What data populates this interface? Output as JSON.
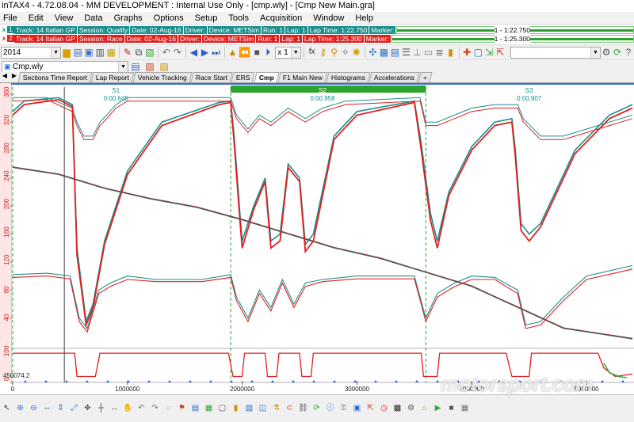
{
  "window": {
    "title": "inTAX4 - 4.72.08.04 - MM DEVELOPMENT : Internal Use Only  - [cmp.wly] - [Cmp New Main.gra]"
  },
  "menu": {
    "items": [
      "File",
      "Edit",
      "View",
      "Data",
      "Graphs",
      "Options",
      "Setup",
      "Tools",
      "Acquisition",
      "Window",
      "Help"
    ]
  },
  "runs": [
    {
      "close": "x",
      "num": "1",
      "color": "#1a8f8f",
      "cells": [
        "Track: 14 Italian GP",
        "Session: Qualify",
        "Date: 02-Aug-16",
        "Driver:",
        "Device: METSim",
        "Run: 1",
        "Lap: 1",
        "Lap Time: 1:22.750",
        "Marker:"
      ],
      "lap_label": "1 - 1:22.750"
    },
    {
      "close": "x",
      "num": "2",
      "color": "#e0201f",
      "cells": [
        "Track: 14 Italian GP",
        "Session: Race",
        "Date: 02-Aug-16",
        "Driver:",
        "Device: METSim",
        "Run: 1",
        "Lap: 1",
        "Lap Time: 1:25.300",
        "Marker:"
      ],
      "lap_label": "1 - 1:25.300"
    }
  ],
  "toolbar": {
    "year_combo": "2014",
    "speed_combo": "x 1",
    "right_combo": "",
    "workspace_combo": "Cmp.wly"
  },
  "tabs": [
    {
      "label": "Sections Time Report",
      "active": false
    },
    {
      "label": "Lap Report",
      "active": false
    },
    {
      "label": "Vehicle Tracking",
      "active": false
    },
    {
      "label": "Race Start",
      "active": false
    },
    {
      "label": "ERS",
      "active": false
    },
    {
      "label": "Cmp",
      "active": true
    },
    {
      "label": "F1 Main New",
      "active": false
    },
    {
      "label": "Histograms",
      "active": false
    },
    {
      "label": "Accelerations",
      "active": false
    },
    {
      "label": "+",
      "active": false
    }
  ],
  "plot": {
    "sectors": [
      {
        "name": "S1",
        "delta": "0:00.645"
      },
      {
        "name": "S2",
        "delta": "0:00.958"
      },
      {
        "name": "S3",
        "delta": "0:00.907"
      }
    ],
    "y_left_ticks_top": [
      "360",
      "320",
      "280",
      "240",
      "200",
      "160",
      "120",
      "80",
      "40"
    ],
    "y_left_ticks_bottom": [
      "100",
      "0"
    ],
    "cursor_value": "450074.2",
    "x_ticks": [
      "0",
      "1000000",
      "2000000",
      "3000000",
      "4000000",
      "5000000"
    ]
  },
  "chart_data": {
    "type": "line",
    "x_range": [
      0,
      5400000
    ],
    "x_ticks": [
      0,
      1000000,
      2000000,
      3000000,
      4000000,
      5000000
    ],
    "series": [
      {
        "color": "#1a8f8f",
        "speed": [
          [
            0,
            335
          ],
          [
            100000,
            350
          ],
          [
            400000,
            355
          ],
          [
            520000,
            345
          ],
          [
            560000,
            140
          ],
          [
            640000,
            35
          ],
          [
            700000,
            60
          ],
          [
            800000,
            150
          ],
          [
            1000000,
            250
          ],
          [
            1300000,
            320
          ],
          [
            1800000,
            348
          ],
          [
            1900000,
            350
          ],
          [
            1930000,
            300
          ],
          [
            1980000,
            190
          ],
          [
            2000000,
            150
          ],
          [
            2100000,
            200
          ],
          [
            2200000,
            240
          ],
          [
            2250000,
            150
          ],
          [
            2330000,
            160
          ],
          [
            2400000,
            260
          ],
          [
            2500000,
            240
          ],
          [
            2550000,
            145
          ],
          [
            2620000,
            160
          ],
          [
            2800000,
            300
          ],
          [
            3000000,
            335
          ],
          [
            3500000,
            350
          ],
          [
            3560000,
            290
          ],
          [
            3640000,
            190
          ],
          [
            3700000,
            150
          ],
          [
            3800000,
            220
          ],
          [
            4000000,
            285
          ],
          [
            4200000,
            320
          ],
          [
            4350000,
            325
          ],
          [
            4380000,
            280
          ],
          [
            4430000,
            175
          ],
          [
            4500000,
            160
          ],
          [
            4600000,
            175
          ],
          [
            4900000,
            280
          ],
          [
            5200000,
            330
          ],
          [
            5400000,
            345
          ]
        ],
        "gear": [
          [
            0,
            355
          ],
          [
            300000,
            355
          ],
          [
            520000,
            340
          ],
          [
            560000,
            320
          ],
          [
            620000,
            300
          ],
          [
            700000,
            300
          ],
          [
            760000,
            320
          ],
          [
            820000,
            330
          ],
          [
            900000,
            345
          ],
          [
            1000000,
            355
          ],
          [
            1900000,
            355
          ],
          [
            1950000,
            330
          ],
          [
            2050000,
            310
          ],
          [
            2150000,
            330
          ],
          [
            2250000,
            320
          ],
          [
            2400000,
            340
          ],
          [
            2550000,
            325
          ],
          [
            2700000,
            340
          ],
          [
            2900000,
            350
          ],
          [
            3550000,
            355
          ],
          [
            3600000,
            320
          ],
          [
            3700000,
            320
          ],
          [
            3850000,
            330
          ],
          [
            4000000,
            340
          ],
          [
            4200000,
            345
          ],
          [
            4400000,
            345
          ],
          [
            4450000,
            325
          ],
          [
            4600000,
            300
          ],
          [
            4800000,
            300
          ],
          [
            5000000,
            310
          ],
          [
            5200000,
            320
          ],
          [
            5400000,
            330
          ]
        ],
        "rpm": [
          [
            0,
            102
          ],
          [
            300000,
            104
          ],
          [
            500000,
            100
          ],
          [
            580000,
            40
          ],
          [
            650000,
            25
          ],
          [
            750000,
            80
          ],
          [
            850000,
            90
          ],
          [
            1000000,
            100
          ],
          [
            1250000,
            95
          ],
          [
            1650000,
            95
          ],
          [
            1900000,
            102
          ],
          [
            1950000,
            70
          ],
          [
            2050000,
            40
          ],
          [
            2150000,
            80
          ],
          [
            2250000,
            55
          ],
          [
            2350000,
            95
          ],
          [
            2450000,
            60
          ],
          [
            2550000,
            90
          ],
          [
            2700000,
            95
          ],
          [
            3000000,
            100
          ],
          [
            3500000,
            100
          ],
          [
            3600000,
            40
          ],
          [
            3700000,
            75
          ],
          [
            3850000,
            90
          ],
          [
            4000000,
            100
          ],
          [
            4200000,
            98
          ],
          [
            4400000,
            80
          ],
          [
            4470000,
            30
          ],
          [
            4600000,
            35
          ],
          [
            4800000,
            70
          ],
          [
            5000000,
            100
          ],
          [
            5400000,
            115
          ]
        ],
        "distance": [
          [
            0,
            255
          ],
          [
            400000,
            245
          ],
          [
            800000,
            225
          ],
          [
            1200000,
            210
          ],
          [
            1600000,
            198
          ],
          [
            2000000,
            180
          ],
          [
            2400000,
            160
          ],
          [
            2800000,
            140
          ],
          [
            3200000,
            125
          ],
          [
            3600000,
            105
          ],
          [
            4000000,
            85
          ],
          [
            4400000,
            55
          ],
          [
            4800000,
            25
          ],
          [
            5200000,
            15
          ],
          [
            5400000,
            10
          ]
        ]
      },
      {
        "color": "#e0201f",
        "speed": [
          [
            0,
            330
          ],
          [
            100000,
            345
          ],
          [
            400000,
            352
          ],
          [
            520000,
            342
          ],
          [
            560000,
            130
          ],
          [
            640000,
            30
          ],
          [
            700000,
            55
          ],
          [
            800000,
            145
          ],
          [
            1000000,
            245
          ],
          [
            1300000,
            315
          ],
          [
            1800000,
            345
          ],
          [
            1900000,
            348
          ],
          [
            1930000,
            290
          ],
          [
            1980000,
            180
          ],
          [
            2000000,
            140
          ],
          [
            2100000,
            195
          ],
          [
            2200000,
            235
          ],
          [
            2250000,
            140
          ],
          [
            2330000,
            150
          ],
          [
            2400000,
            255
          ],
          [
            2500000,
            235
          ],
          [
            2550000,
            135
          ],
          [
            2620000,
            150
          ],
          [
            2800000,
            295
          ],
          [
            3000000,
            330
          ],
          [
            3500000,
            348
          ],
          [
            3560000,
            280
          ],
          [
            3640000,
            180
          ],
          [
            3700000,
            140
          ],
          [
            3800000,
            215
          ],
          [
            4000000,
            280
          ],
          [
            4200000,
            315
          ],
          [
            4350000,
            320
          ],
          [
            4380000,
            270
          ],
          [
            4430000,
            165
          ],
          [
            4500000,
            150
          ],
          [
            4600000,
            170
          ],
          [
            4900000,
            275
          ],
          [
            5200000,
            325
          ],
          [
            5400000,
            340
          ]
        ],
        "gear": [
          [
            0,
            350
          ],
          [
            300000,
            352
          ],
          [
            520000,
            335
          ],
          [
            560000,
            315
          ],
          [
            620000,
            295
          ],
          [
            700000,
            295
          ],
          [
            760000,
            315
          ],
          [
            820000,
            325
          ],
          [
            900000,
            340
          ],
          [
            1000000,
            350
          ],
          [
            1900000,
            350
          ],
          [
            1950000,
            325
          ],
          [
            2050000,
            305
          ],
          [
            2150000,
            325
          ],
          [
            2250000,
            315
          ],
          [
            2400000,
            335
          ],
          [
            2550000,
            320
          ],
          [
            2700000,
            335
          ],
          [
            2900000,
            345
          ],
          [
            3550000,
            350
          ],
          [
            3600000,
            315
          ],
          [
            3700000,
            315
          ],
          [
            3850000,
            325
          ],
          [
            4000000,
            335
          ],
          [
            4200000,
            340
          ],
          [
            4400000,
            340
          ],
          [
            4450000,
            320
          ],
          [
            4600000,
            295
          ],
          [
            4800000,
            295
          ],
          [
            5000000,
            305
          ],
          [
            5200000,
            315
          ],
          [
            5400000,
            325
          ]
        ],
        "rpm": [
          [
            0,
            98
          ],
          [
            300000,
            100
          ],
          [
            500000,
            96
          ],
          [
            580000,
            35
          ],
          [
            650000,
            20
          ],
          [
            750000,
            75
          ],
          [
            850000,
            85
          ],
          [
            1000000,
            95
          ],
          [
            1250000,
            92
          ],
          [
            1650000,
            92
          ],
          [
            1900000,
            98
          ],
          [
            1950000,
            65
          ],
          [
            2050000,
            35
          ],
          [
            2150000,
            75
          ],
          [
            2250000,
            50
          ],
          [
            2350000,
            90
          ],
          [
            2450000,
            55
          ],
          [
            2550000,
            85
          ],
          [
            2700000,
            92
          ],
          [
            3000000,
            96
          ],
          [
            3500000,
            96
          ],
          [
            3600000,
            35
          ],
          [
            3700000,
            70
          ],
          [
            3850000,
            85
          ],
          [
            4000000,
            95
          ],
          [
            4200000,
            95
          ],
          [
            4400000,
            75
          ],
          [
            4470000,
            25
          ],
          [
            4600000,
            30
          ],
          [
            4800000,
            65
          ],
          [
            5000000,
            95
          ],
          [
            5400000,
            110
          ]
        ],
        "distance": [
          [
            0,
            256
          ],
          [
            400000,
            246
          ],
          [
            800000,
            226
          ],
          [
            1200000,
            211
          ],
          [
            1600000,
            199
          ],
          [
            2000000,
            181
          ],
          [
            2400000,
            161
          ],
          [
            2800000,
            141
          ],
          [
            3200000,
            126
          ],
          [
            3600000,
            106
          ],
          [
            4000000,
            86
          ],
          [
            4400000,
            56
          ],
          [
            4800000,
            26
          ],
          [
            5200000,
            16
          ],
          [
            5400000,
            11
          ]
        ]
      }
    ],
    "sector_boundaries": [
      0,
      1900000,
      3600000
    ],
    "cursor_x": 450000
  },
  "statusbar": {
    "icons": [
      "pointer-icon",
      "zoom-in-icon",
      "zoom-out-icon",
      "zoom-x-icon",
      "zoom-y-icon",
      "zoom-fit-icon",
      "pan-icon",
      "cursor-icon",
      "measure-icon",
      "hand-icon",
      "undo-icon",
      "redo-icon",
      "lasso-icon",
      "flag-icon",
      "chart-icon",
      "table-icon",
      "box-icon",
      "bars-icon",
      "overlay-icon",
      "split-icon",
      "filter-icon",
      "magnet-icon",
      "link-icon",
      "refresh-icon",
      "info-icon",
      "lock-icon",
      "save-icon",
      "export-icon",
      "timer-icon",
      "checker-icon",
      "settings-icon",
      "tag-icon",
      "play-icon",
      "stop-icon",
      "grid-icon"
    ]
  },
  "watermark": "motorsport.com"
}
